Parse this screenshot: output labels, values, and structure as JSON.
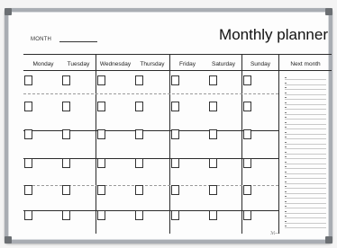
{
  "planner": {
    "title": "Monthly planner",
    "month_label": "MONTH",
    "days": [
      "Monday",
      "Tuesday",
      "Wednesday",
      "Thursday",
      "Friday",
      "Saturday",
      "Sunday"
    ],
    "next_month_label": "Next month",
    "signature": "ℳ—"
  }
}
